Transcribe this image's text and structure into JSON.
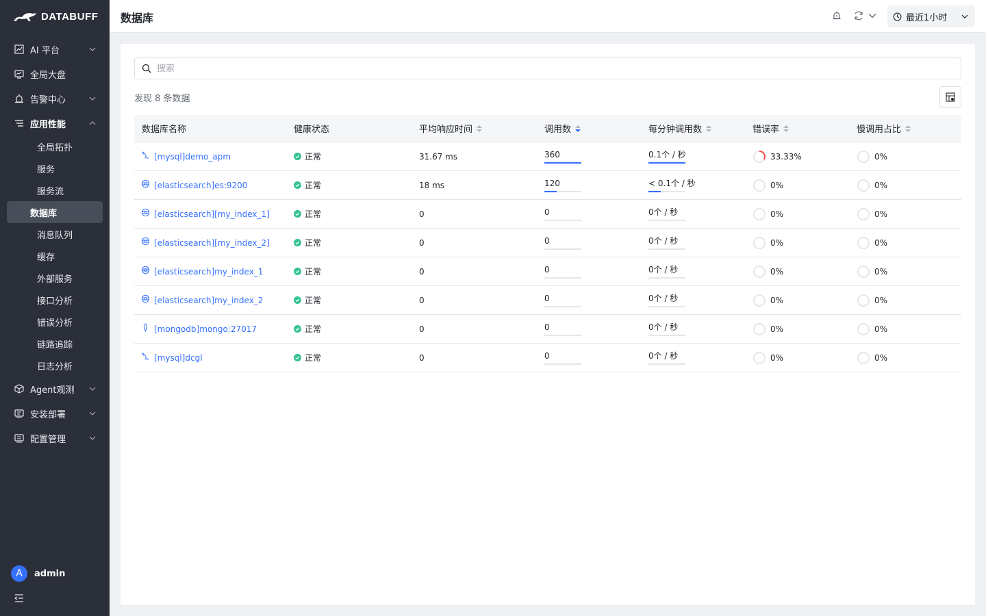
{
  "brand": {
    "name": "DATABUFF"
  },
  "sidebar": {
    "items": [
      {
        "label": "AI 平台",
        "icon": "chart-line-icon",
        "expandable": true
      },
      {
        "label": "全局大盘",
        "icon": "dashboard-icon",
        "expandable": false
      },
      {
        "label": "告警中心",
        "icon": "alarm-icon",
        "expandable": true
      },
      {
        "label": "应用性能",
        "icon": "list-icon",
        "expandable": true,
        "expanded": true
      }
    ],
    "sub_items": [
      {
        "label": "全局拓扑"
      },
      {
        "label": "服务"
      },
      {
        "label": "服务流"
      },
      {
        "label": "数据库",
        "active": true
      },
      {
        "label": "消息队列"
      },
      {
        "label": "缓存"
      },
      {
        "label": "外部服务"
      },
      {
        "label": "接口分析"
      },
      {
        "label": "错误分析"
      },
      {
        "label": "链路追踪"
      },
      {
        "label": "日志分析"
      }
    ],
    "bottom_items": [
      {
        "label": "Agent观测",
        "icon": "cube-icon"
      },
      {
        "label": "安装部署",
        "icon": "install-icon"
      },
      {
        "label": "配置管理",
        "icon": "config-icon"
      }
    ],
    "user": {
      "initial": "A",
      "name": "admin"
    }
  },
  "header": {
    "title": "数据库",
    "time_range": "最近1小时"
  },
  "search": {
    "placeholder": "搜索"
  },
  "summary": "发现 8 条数据",
  "table": {
    "columns": [
      "数据库名称",
      "健康状态",
      "平均响应时间",
      "调用数",
      "每分钟调用数",
      "错误率",
      "慢调用占比"
    ],
    "sort": {
      "column": "调用数",
      "direction": "desc"
    },
    "rows": [
      {
        "type": "mysql",
        "name": "[mysql]demo_apm",
        "status": "正常",
        "avg_response": "31.67 ms",
        "calls": "360",
        "calls_fill": 1.0,
        "cpm": "0.1个 / 秒",
        "cpm_fill": 1.0,
        "error_rate": "33.33%",
        "error_fraction": 0.3333,
        "slow_rate": "0%"
      },
      {
        "type": "elasticsearch",
        "name": "[elasticsearch]es:9200",
        "status": "正常",
        "avg_response": "18 ms",
        "calls": "120",
        "calls_fill": 0.333,
        "cpm": "< 0.1个 / 秒",
        "cpm_fill": 0.333,
        "error_rate": "0%",
        "error_fraction": 0,
        "slow_rate": "0%"
      },
      {
        "type": "elasticsearch",
        "name": "[elasticsearch][my_index_1]",
        "status": "正常",
        "avg_response": "0",
        "calls": "0",
        "calls_fill": 0,
        "cpm": "0个 / 秒",
        "cpm_fill": 0,
        "error_rate": "0%",
        "error_fraction": 0,
        "slow_rate": "0%"
      },
      {
        "type": "elasticsearch",
        "name": "[elasticsearch][my_index_2]",
        "status": "正常",
        "avg_response": "0",
        "calls": "0",
        "calls_fill": 0,
        "cpm": "0个 / 秒",
        "cpm_fill": 0,
        "error_rate": "0%",
        "error_fraction": 0,
        "slow_rate": "0%"
      },
      {
        "type": "elasticsearch",
        "name": "[elasticsearch]my_index_1",
        "status": "正常",
        "avg_response": "0",
        "calls": "0",
        "calls_fill": 0,
        "cpm": "0个 / 秒",
        "cpm_fill": 0,
        "error_rate": "0%",
        "error_fraction": 0,
        "slow_rate": "0%"
      },
      {
        "type": "elasticsearch",
        "name": "[elasticsearch]my_index_2",
        "status": "正常",
        "avg_response": "0",
        "calls": "0",
        "calls_fill": 0,
        "cpm": "0个 / 秒",
        "cpm_fill": 0,
        "error_rate": "0%",
        "error_fraction": 0,
        "slow_rate": "0%"
      },
      {
        "type": "mongodb",
        "name": "[mongodb]mongo:27017",
        "status": "正常",
        "avg_response": "0",
        "calls": "0",
        "calls_fill": 0,
        "cpm": "0个 / 秒",
        "cpm_fill": 0,
        "error_rate": "0%",
        "error_fraction": 0,
        "slow_rate": "0%"
      },
      {
        "type": "mysql",
        "name": "[mysql]dcgl",
        "status": "正常",
        "avg_response": "0",
        "calls": "0",
        "calls_fill": 0,
        "cpm": "0个 / 秒",
        "cpm_fill": 0,
        "error_rate": "0%",
        "error_fraction": 0,
        "slow_rate": "0%"
      }
    ]
  },
  "colors": {
    "accent": "#3370ff",
    "sidebar_bg": "#2b2f3a",
    "ok": "#34c38f",
    "error": "#f54a45"
  }
}
